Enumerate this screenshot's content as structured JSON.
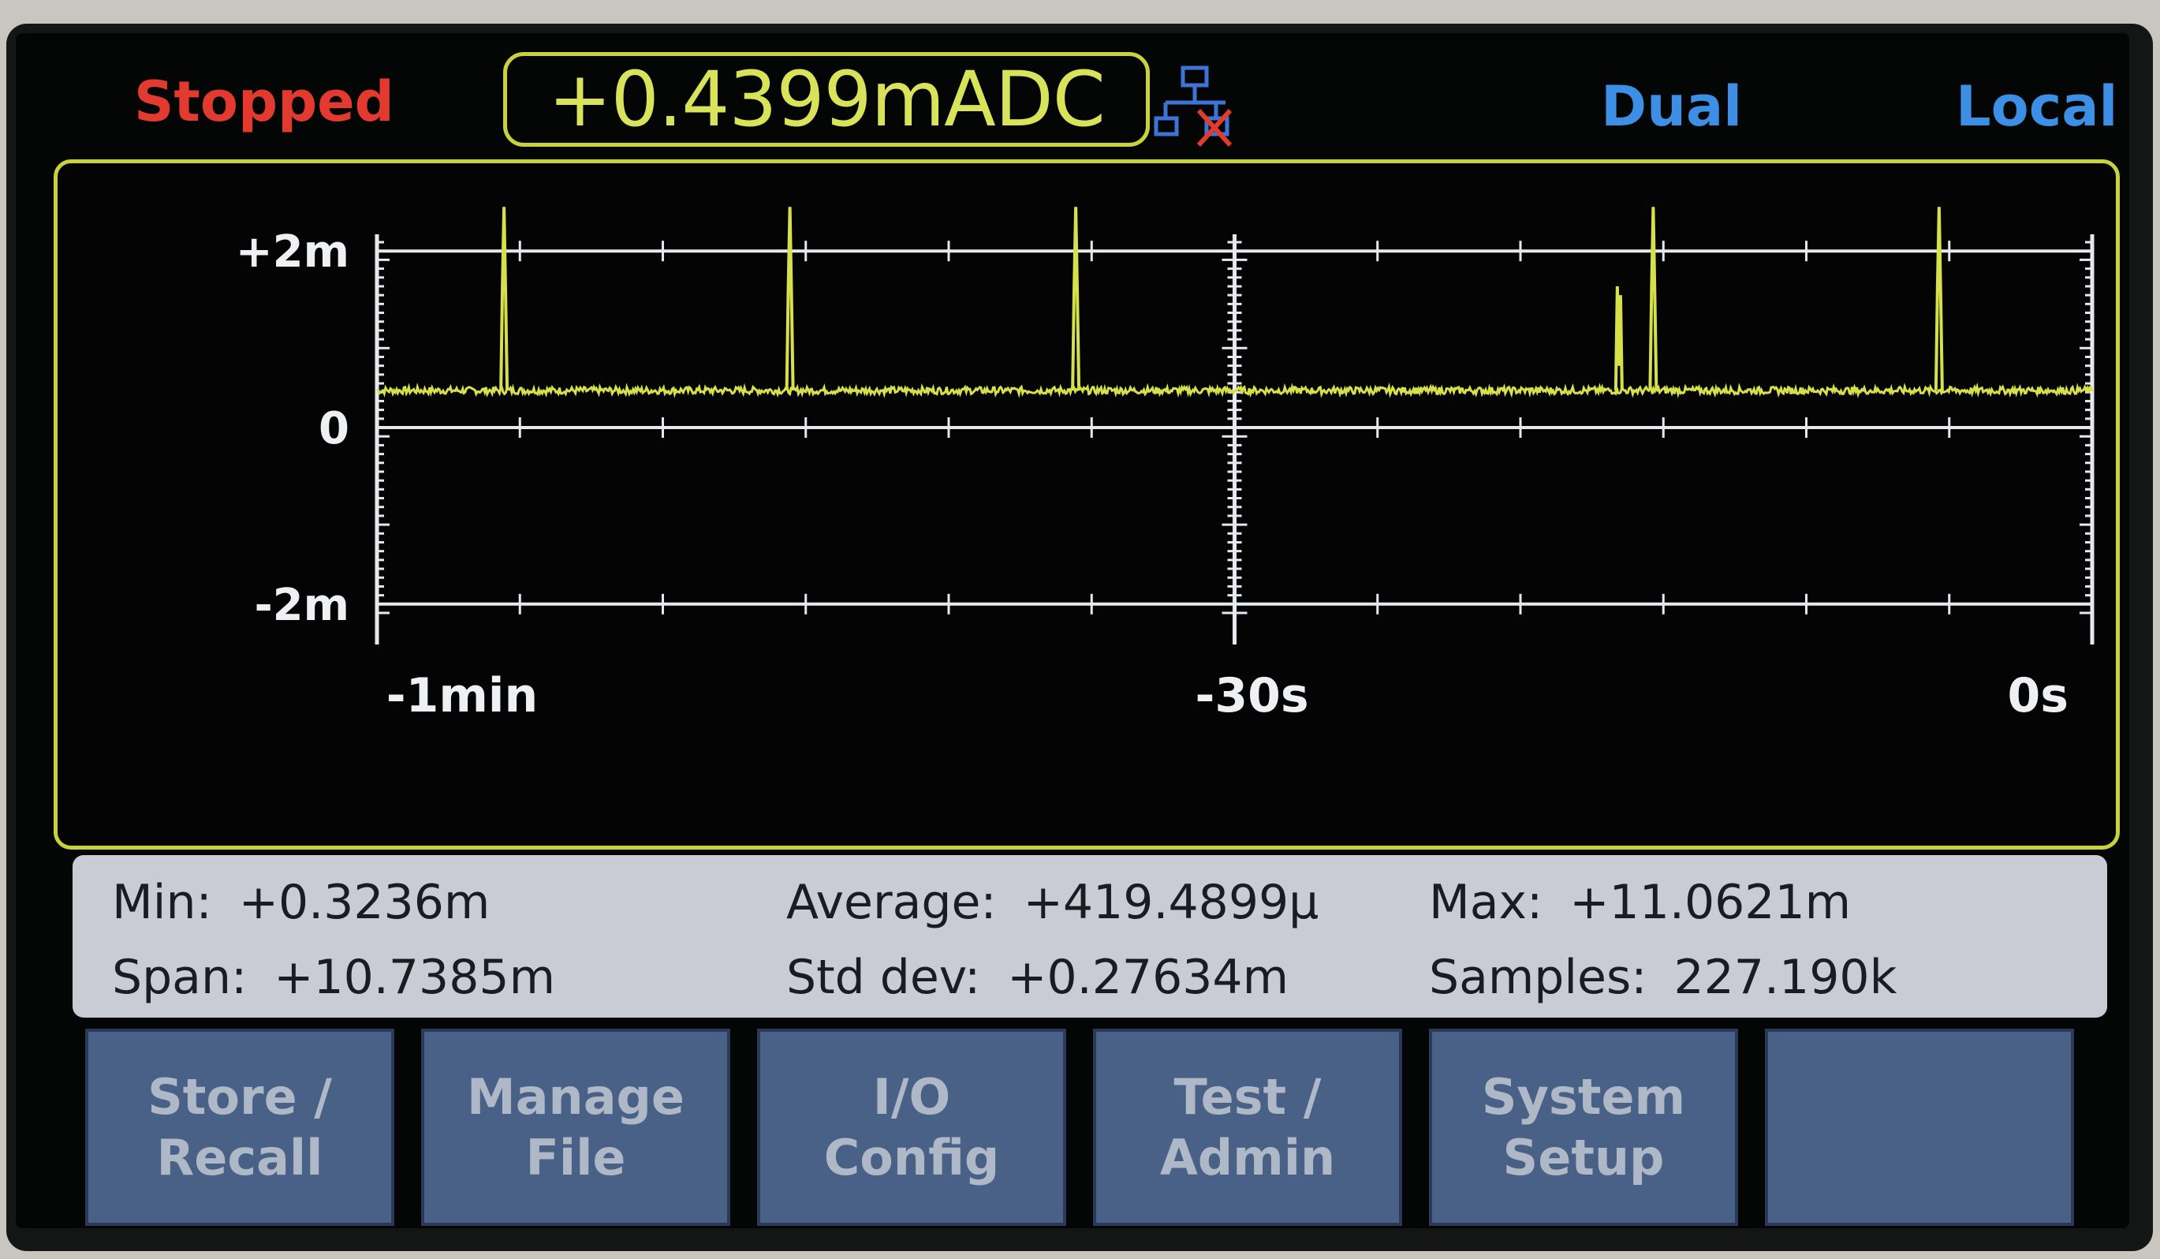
{
  "status": {
    "state": "Stopped",
    "state_color": "#e23a2e",
    "mode": "Dual",
    "remote": "Local",
    "mode_color": "#3d8fe6"
  },
  "reading": {
    "value": "+0.4399mADC",
    "color": "#d9e35a",
    "border_color": "#c8d23a"
  },
  "network_icon": "lan-disconnected-icon",
  "chart_data": {
    "type": "line",
    "title": "",
    "xlabel": "",
    "ylabel": "",
    "x_tick_labels": [
      "-1min",
      "-30s",
      "0s"
    ],
    "y_tick_labels": [
      "+2m",
      "0",
      "-2m"
    ],
    "xlim_s": [
      -60,
      0
    ],
    "ylim_mA": [
      -2.1,
      2.1
    ],
    "grid": true,
    "series": [
      {
        "color": "#d6e04a",
        "baseline_mA": 0.42,
        "spikes": [
          {
            "t_s": -55.5,
            "peak_mA": 2.5
          },
          {
            "t_s": -45.5,
            "peak_mA": 2.5
          },
          {
            "t_s": -35.5,
            "peak_mA": 2.5
          },
          {
            "t_s": -16.5,
            "peak_mA": 0.7
          },
          {
            "t_s": -15.3,
            "peak_mA": 2.5
          },
          {
            "t_s": -5.3,
            "peak_mA": 2.5
          }
        ]
      }
    ]
  },
  "stats": {
    "min_label": "Min:",
    "min_value": "+0.3236m",
    "span_label": "Span:",
    "span_value": "+10.7385m",
    "avg_label": "Average:",
    "avg_value": "+419.4899μ",
    "std_label": "Std dev:",
    "std_value": "+0.27634m",
    "max_label": "Max:",
    "max_value": "+11.0621m",
    "samples_label": "Samples:",
    "samples_value": "227.190k"
  },
  "softkeys": [
    "Store /\nRecall",
    "Manage\nFile",
    "I/O\nConfig",
    "Test /\nAdmin",
    "System\nSetup",
    ""
  ]
}
